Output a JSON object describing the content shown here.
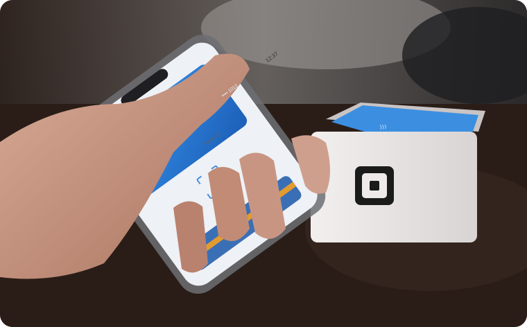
{
  "phone": {
    "status_time": "12:37",
    "card_text": "•••• 1012",
    "face_id_label": "Face ID"
  },
  "reader": {
    "screen_text": "))) "
  },
  "colors": {
    "table": "#2a1d17",
    "card_blue": "#2f7fd8",
    "reader_body": "#e9e6e6",
    "square_logo": "#1b1b1b",
    "skin": "#c99a86"
  }
}
